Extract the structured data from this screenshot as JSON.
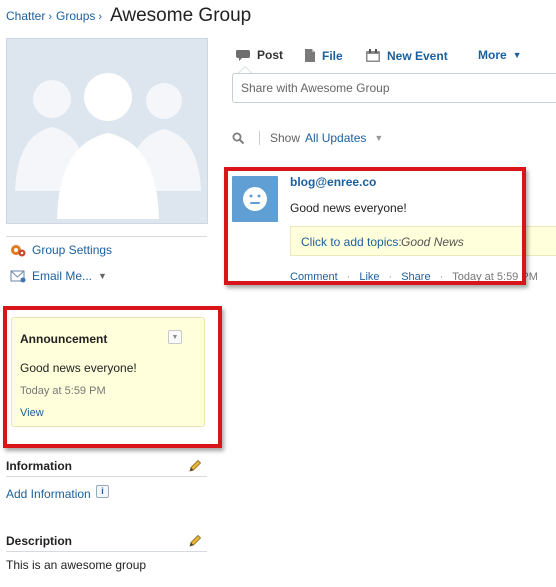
{
  "breadcrumb": {
    "items": [
      "Chatter",
      "Groups"
    ],
    "separator": "›"
  },
  "page_title": "Awesome Group",
  "sidebar": {
    "group_settings": "Group Settings",
    "email_me": "Email Me...",
    "announcement": {
      "title": "Announcement",
      "text": "Good news everyone!",
      "time": "Today at 5:59 PM",
      "view": "View"
    },
    "information": {
      "heading": "Information",
      "add_link": "Add Information",
      "info_icon": "i"
    },
    "description": {
      "heading": "Description",
      "text": "This is an awesome group"
    }
  },
  "publisher": {
    "tabs": [
      {
        "label": "Post",
        "icon": "post-icon"
      },
      {
        "label": "File",
        "icon": "file-icon"
      },
      {
        "label": "New Event",
        "icon": "event-icon"
      },
      {
        "label": "More",
        "icon": "chevron-down-icon"
      }
    ],
    "placeholder": "Share with Awesome Group"
  },
  "feed_filter": {
    "show_label": "Show",
    "value": "All Updates"
  },
  "post": {
    "author": "blog@enree.co",
    "body": "Good news everyone!",
    "topics_prompt": "Click to add topics:",
    "topic": "Good News",
    "actions": [
      "Comment",
      "Like",
      "Share"
    ],
    "time": "Today at 5:59 PM"
  },
  "colors": {
    "link": "#1b5f9e",
    "highlight_box": "#d9151c",
    "announcement_bg": "#ffffdc"
  }
}
